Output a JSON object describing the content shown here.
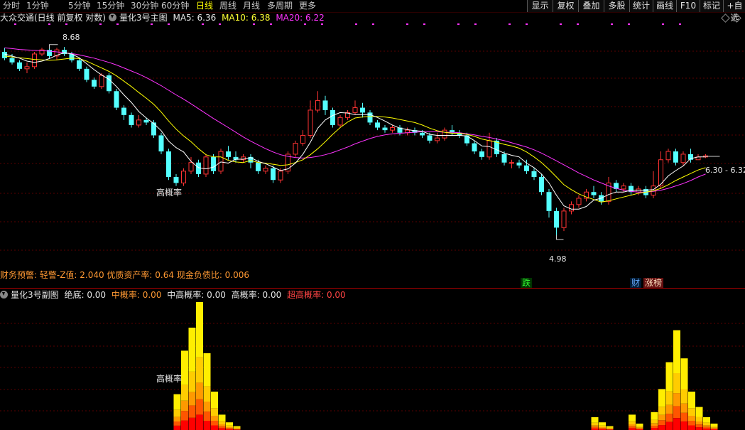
{
  "periods": [
    "分时",
    "1分钟",
    "5分钟",
    "15分钟",
    "30分钟",
    "60分钟",
    "日线",
    "周线",
    "月线",
    "多周期",
    "更多"
  ],
  "active_period": "日线",
  "tools": [
    "显示",
    "复权",
    "叠加",
    "多股",
    "统计",
    "画线",
    "F10",
    "标记",
    "+自选"
  ],
  "main": {
    "title": "大众交通(日线 前复权 对数)",
    "indicator": "量化3号主图",
    "ma5": "MA5: 6.36",
    "ma10": "MA10: 6.38",
    "ma20": "MA20: 6.22",
    "high_label": "8.68",
    "low_label": "4.98",
    "last_label": "6.30 - 6.32",
    "signal_label": "高概率",
    "finance_alert": "财务预警: 轻警-Z值: 2.040 优质资产率: 0.64 现金负债比: 0.006",
    "tag_die": "跌",
    "tag_cai": "财",
    "tag_zhang": "涨榜",
    "colors": {
      "up": "#ff3333",
      "down": "#54ffff",
      "ma5": "#ffffff",
      "ma10": "#ffff00",
      "ma20": "#ff33ff"
    }
  },
  "sub": {
    "indicator": "量化3号副图",
    "jue_di": "绝底: 0.00",
    "zhong": "中概率: 0.00",
    "zhong_gao": "中高概率: 0.00",
    "gao": "高概率: 0.00",
    "chao_gao": "超高概率: 0.00",
    "signal_label": "高概率"
  },
  "chart_data": {
    "type": "candlestick",
    "ylim": [
      4.6,
      9.2
    ],
    "high": 8.68,
    "low": 4.98,
    "last": 6.31,
    "candles": [
      [
        8.5,
        8.35,
        8.6,
        8.3
      ],
      [
        8.35,
        8.25,
        8.45,
        8.2
      ],
      [
        8.25,
        8.1,
        8.3,
        8.05
      ],
      [
        8.1,
        8.15,
        8.25,
        8.0
      ],
      [
        8.15,
        8.45,
        8.5,
        8.1
      ],
      [
        8.45,
        8.55,
        8.6,
        8.4
      ],
      [
        8.55,
        8.4,
        8.68,
        8.35
      ],
      [
        8.4,
        8.55,
        8.6,
        8.3
      ],
      [
        8.55,
        8.45,
        8.62,
        8.4
      ],
      [
        8.45,
        8.3,
        8.5,
        8.25
      ],
      [
        8.3,
        8.1,
        8.35,
        8.05
      ],
      [
        8.1,
        7.85,
        8.15,
        7.8
      ],
      [
        7.85,
        7.7,
        7.9,
        7.65
      ],
      [
        7.7,
        7.95,
        8.0,
        7.65
      ],
      [
        7.95,
        7.6,
        8.0,
        7.55
      ],
      [
        7.6,
        7.25,
        7.65,
        7.2
      ],
      [
        7.25,
        7.1,
        7.3,
        7.0
      ],
      [
        7.1,
        6.9,
        7.15,
        6.85
      ],
      [
        6.9,
        7.0,
        7.1,
        6.85
      ],
      [
        7.0,
        6.95,
        7.05,
        6.9
      ],
      [
        6.95,
        6.7,
        7.0,
        6.65
      ],
      [
        6.7,
        6.4,
        6.75,
        6.35
      ],
      [
        6.4,
        5.95,
        6.45,
        5.9
      ],
      [
        5.95,
        5.85,
        6.0,
        5.8
      ],
      [
        5.85,
        6.05,
        6.1,
        5.8
      ],
      [
        6.05,
        6.2,
        6.3,
        6.0
      ],
      [
        6.2,
        6.0,
        6.25,
        5.95
      ],
      [
        6.0,
        6.3,
        6.35,
        5.95
      ],
      [
        6.3,
        6.05,
        6.35,
        6.0
      ],
      [
        6.05,
        6.4,
        6.45,
        6.0
      ],
      [
        6.4,
        6.3,
        6.5,
        6.25
      ],
      [
        6.3,
        6.25,
        6.4,
        6.2
      ],
      [
        6.25,
        6.3,
        6.35,
        6.2
      ],
      [
        6.3,
        6.2,
        6.35,
        6.1
      ],
      [
        6.2,
        6.05,
        6.25,
        6.0
      ],
      [
        6.05,
        6.1,
        6.15,
        6.0
      ],
      [
        6.1,
        5.9,
        6.15,
        5.85
      ],
      [
        5.9,
        6.05,
        6.1,
        5.85
      ],
      [
        6.05,
        6.35,
        6.4,
        6.0
      ],
      [
        6.35,
        6.55,
        6.6,
        6.3
      ],
      [
        6.55,
        6.7,
        6.8,
        6.5
      ],
      [
        6.7,
        7.2,
        7.4,
        6.65
      ],
      [
        7.2,
        7.4,
        7.6,
        7.15
      ],
      [
        7.4,
        7.2,
        7.5,
        7.1
      ],
      [
        7.2,
        6.9,
        7.25,
        6.85
      ],
      [
        6.9,
        7.05,
        7.1,
        6.85
      ],
      [
        7.05,
        7.15,
        7.2,
        7.0
      ],
      [
        7.15,
        7.25,
        7.4,
        7.1
      ],
      [
        7.25,
        7.15,
        7.35,
        7.05
      ],
      [
        7.15,
        6.95,
        7.2,
        6.9
      ],
      [
        6.95,
        6.85,
        7.0,
        6.8
      ],
      [
        6.85,
        6.8,
        6.9,
        6.75
      ],
      [
        6.8,
        6.85,
        6.9,
        6.75
      ],
      [
        6.85,
        6.75,
        6.9,
        6.7
      ],
      [
        6.75,
        6.8,
        6.85,
        6.7
      ],
      [
        6.8,
        6.75,
        6.85,
        6.7
      ],
      [
        6.75,
        6.7,
        6.8,
        6.65
      ],
      [
        6.7,
        6.6,
        6.75,
        6.55
      ],
      [
        6.6,
        6.65,
        6.75,
        6.55
      ],
      [
        6.65,
        6.8,
        6.85,
        6.6
      ],
      [
        6.8,
        6.75,
        6.9,
        6.7
      ],
      [
        6.75,
        6.7,
        6.8,
        6.65
      ],
      [
        6.7,
        6.55,
        6.75,
        6.5
      ],
      [
        6.55,
        6.4,
        6.6,
        6.35
      ],
      [
        6.4,
        6.3,
        6.45,
        6.25
      ],
      [
        6.3,
        6.6,
        6.75,
        6.25
      ],
      [
        6.6,
        6.35,
        6.65,
        6.3
      ],
      [
        6.35,
        6.2,
        6.4,
        6.15
      ],
      [
        6.2,
        6.2,
        6.25,
        6.1
      ],
      [
        6.2,
        6.15,
        6.25,
        6.1
      ],
      [
        6.15,
        6.05,
        6.25,
        6.0
      ],
      [
        6.05,
        5.95,
        6.1,
        5.9
      ],
      [
        5.95,
        5.7,
        6.0,
        5.65
      ],
      [
        5.7,
        5.4,
        5.75,
        5.3
      ],
      [
        5.4,
        5.15,
        5.45,
        4.98
      ],
      [
        5.15,
        5.4,
        5.45,
        5.1
      ],
      [
        5.4,
        5.5,
        5.55,
        5.35
      ],
      [
        5.5,
        5.6,
        5.65,
        5.45
      ],
      [
        5.6,
        5.7,
        5.75,
        5.55
      ],
      [
        5.7,
        5.65,
        5.8,
        5.6
      ],
      [
        5.65,
        5.55,
        5.7,
        5.5
      ],
      [
        5.55,
        5.85,
        5.95,
        5.5
      ],
      [
        5.85,
        5.75,
        5.9,
        5.7
      ],
      [
        5.75,
        5.8,
        5.85,
        5.7
      ],
      [
        5.8,
        5.7,
        5.85,
        5.65
      ],
      [
        5.7,
        5.75,
        5.8,
        5.65
      ],
      [
        5.75,
        5.65,
        5.8,
        5.6
      ],
      [
        5.65,
        5.8,
        6.05,
        5.6
      ],
      [
        5.8,
        6.25,
        6.4,
        5.75
      ],
      [
        6.25,
        6.4,
        6.45,
        6.2
      ],
      [
        6.4,
        6.2,
        6.45,
        6.15
      ],
      [
        6.2,
        6.35,
        6.4,
        6.15
      ],
      [
        6.35,
        6.25,
        6.45,
        6.2
      ],
      [
        6.25,
        6.3,
        6.35,
        6.25
      ],
      [
        6.3,
        6.32,
        6.35,
        6.28
      ]
    ],
    "ma5": [
      8.45,
      8.4,
      8.35,
      8.28,
      8.25,
      8.28,
      8.34,
      8.42,
      8.48,
      8.45,
      8.36,
      8.22,
      8.08,
      7.96,
      7.86,
      7.7,
      7.52,
      7.36,
      7.17,
      7.04,
      6.93,
      6.79,
      6.59,
      6.47,
      6.39,
      6.22,
      6.11,
      6.09,
      6.12,
      6.21,
      6.19,
      6.26,
      6.26,
      6.29,
      6.22,
      6.18,
      6.12,
      6.06,
      6.09,
      6.19,
      6.35,
      6.57,
      6.84,
      7.0,
      7.09,
      7.15,
      7.14,
      7.11,
      7.11,
      7.11,
      7.05,
      6.98,
      6.9,
      6.84,
      6.81,
      6.79,
      6.78,
      6.72,
      6.7,
      6.7,
      6.7,
      6.7,
      6.69,
      6.6,
      6.5,
      6.49,
      6.43,
      6.37,
      6.33,
      6.3,
      6.19,
      6.11,
      6.0,
      5.85,
      5.65,
      5.48,
      5.43,
      5.43,
      5.47,
      5.57,
      5.6,
      5.66,
      5.7,
      5.7,
      5.73,
      5.73,
      5.73,
      5.74,
      5.83,
      5.97,
      6.06,
      6.14,
      6.27,
      6.3,
      6.3
    ],
    "ma10": [
      8.4,
      8.38,
      8.36,
      8.34,
      8.32,
      8.31,
      8.3,
      8.31,
      8.33,
      8.35,
      8.34,
      8.28,
      8.2,
      8.12,
      8.04,
      7.94,
      7.82,
      7.7,
      7.57,
      7.45,
      7.32,
      7.16,
      6.98,
      6.82,
      6.69,
      6.58,
      6.45,
      6.34,
      6.3,
      6.3,
      6.24,
      6.21,
      6.2,
      6.24,
      6.2,
      6.19,
      6.17,
      6.15,
      6.16,
      6.2,
      6.25,
      6.34,
      6.45,
      6.58,
      6.72,
      6.85,
      6.96,
      7.04,
      7.06,
      7.07,
      7.07,
      7.06,
      7.04,
      7.01,
      6.98,
      6.95,
      6.9,
      6.84,
      6.79,
      6.76,
      6.74,
      6.74,
      6.72,
      6.68,
      6.63,
      6.6,
      6.57,
      6.53,
      6.5,
      6.46,
      6.39,
      6.3,
      6.2,
      6.08,
      5.95,
      5.82,
      5.74,
      5.67,
      5.62,
      5.58,
      5.54,
      5.56,
      5.59,
      5.62,
      5.65,
      5.68,
      5.7,
      5.72,
      5.76,
      5.82,
      5.89,
      5.95,
      6.01,
      6.07,
      6.11
    ],
    "ma20": [
      8.6,
      8.58,
      8.56,
      8.55,
      8.54,
      8.53,
      8.52,
      8.5,
      8.48,
      8.46,
      8.43,
      8.39,
      8.35,
      8.3,
      8.25,
      8.19,
      8.12,
      8.05,
      7.98,
      7.9,
      7.81,
      7.72,
      7.62,
      7.52,
      7.43,
      7.33,
      7.23,
      7.13,
      7.03,
      6.94,
      6.85,
      6.76,
      6.67,
      6.59,
      6.52,
      6.45,
      6.39,
      6.34,
      6.31,
      6.29,
      6.28,
      6.29,
      6.31,
      6.34,
      6.38,
      6.43,
      6.48,
      6.54,
      6.59,
      6.64,
      6.68,
      6.71,
      6.73,
      6.74,
      6.75,
      6.76,
      6.77,
      6.77,
      6.77,
      6.76,
      6.76,
      6.75,
      6.73,
      6.71,
      6.68,
      6.66,
      6.63,
      6.6,
      6.56,
      6.52,
      6.48,
      6.43,
      6.37,
      6.3,
      6.23,
      6.16,
      6.09,
      6.02,
      5.96,
      5.9,
      5.85,
      5.8,
      5.76,
      5.73,
      5.71,
      5.7,
      5.7,
      5.71,
      5.73,
      5.76,
      5.8,
      5.84,
      5.89,
      5.95,
      6.0
    ],
    "sub_bars": [
      {
        "i": 23,
        "h": 0.28
      },
      {
        "i": 24,
        "h": 0.62
      },
      {
        "i": 25,
        "h": 0.8
      },
      {
        "i": 26,
        "h": 1.0
      },
      {
        "i": 27,
        "h": 0.6
      },
      {
        "i": 28,
        "h": 0.3
      },
      {
        "i": 29,
        "h": 0.12
      },
      {
        "i": 30,
        "h": 0.06
      },
      {
        "i": 31,
        "h": 0.03
      },
      {
        "i": 79,
        "h": 0.1
      },
      {
        "i": 80,
        "h": 0.06
      },
      {
        "i": 81,
        "h": 0.03
      },
      {
        "i": 84,
        "h": 0.12
      },
      {
        "i": 85,
        "h": 0.05
      },
      {
        "i": 87,
        "h": 0.14
      },
      {
        "i": 88,
        "h": 0.32
      },
      {
        "i": 89,
        "h": 0.53
      },
      {
        "i": 90,
        "h": 0.78
      },
      {
        "i": 91,
        "h": 0.56
      },
      {
        "i": 92,
        "h": 0.3
      },
      {
        "i": 93,
        "h": 0.18
      },
      {
        "i": 94,
        "h": 0.1
      },
      {
        "i": 95,
        "h": 0.05
      }
    ]
  }
}
